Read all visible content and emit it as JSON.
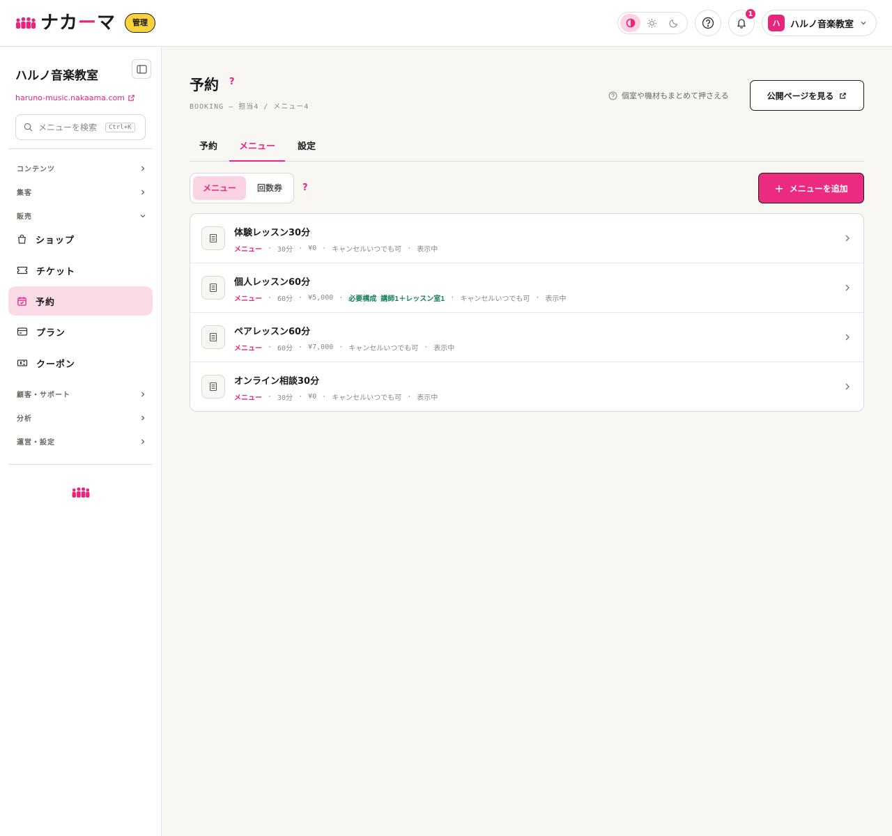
{
  "brand": {
    "name_main": "ナカ",
    "name_dash": "ー",
    "name_tail": "マ",
    "badge": "管理",
    "accent": "#e8257a",
    "badge_color": "#f9d23c"
  },
  "header": {
    "theme_modes": [
      "contrast-icon",
      "sun-icon",
      "moon-icon"
    ],
    "notifications_count": "1",
    "account": {
      "avatar": "ハ",
      "name": "ハルノ音楽教室"
    }
  },
  "sidebar": {
    "shop_name": "ハルノ音楽教室",
    "shop_url": "haruno-music.nakaama.com",
    "search_placeholder": "メニューを検索",
    "search_shortcut": "Ctrl+K",
    "sections": {
      "contents": "コンテンツ",
      "marketing": "集客",
      "sales": "販売",
      "customer": "顧客・サポート",
      "analytics": "分析",
      "operations": "運営・設定"
    },
    "items": [
      {
        "label": "ショップ",
        "icon": "bag-icon"
      },
      {
        "label": "チケット",
        "icon": "ticket-icon"
      },
      {
        "label": "予約",
        "icon": "calendar-icon",
        "active": true
      },
      {
        "label": "プラン",
        "icon": "card-icon"
      },
      {
        "label": "クーポン",
        "icon": "coupon-icon"
      }
    ]
  },
  "page": {
    "title": "予約",
    "help": "?",
    "breadcrumb": "BOOKING — 担当4 / メニュー4",
    "hint": "個室や機材もまとめて押さえる",
    "public_button": "公開ページを見る"
  },
  "tabs": [
    "予約",
    "メニュー",
    "設定"
  ],
  "active_tab": "メニュー",
  "segments": [
    "メニュー",
    "回数券"
  ],
  "add_button": "メニューを追加",
  "menus": [
    {
      "title": "体験レッスン30分",
      "tag": "メニュー",
      "duration": "30分",
      "price": "¥0",
      "requirement": "",
      "cancel": "キャンセルいつでも可",
      "status": "表示中"
    },
    {
      "title": "個人レッスン60分",
      "tag": "メニュー",
      "duration": "60分",
      "price": "¥5,000",
      "requirement": "必要構成 講師1＋レッスン室1",
      "cancel": "キャンセルいつでも可",
      "status": "表示中"
    },
    {
      "title": "ペアレッスン60分",
      "tag": "メニュー",
      "duration": "60分",
      "price": "¥7,000",
      "requirement": "",
      "cancel": "キャンセルいつでも可",
      "status": "表示中"
    },
    {
      "title": "オンライン相談30分",
      "tag": "メニュー",
      "duration": "30分",
      "price": "¥0",
      "requirement": "",
      "cancel": "キャンセルいつでも可",
      "status": "表示中"
    }
  ]
}
